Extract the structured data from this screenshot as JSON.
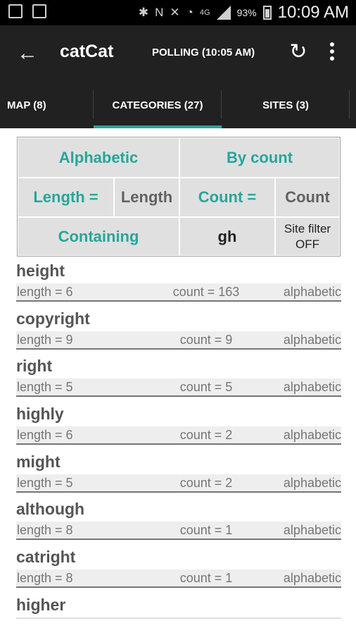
{
  "status_bar": {
    "battery": "93%",
    "time": "10:09 AM",
    "network": "4G"
  },
  "app_bar": {
    "title": "catCat",
    "polling": "POLLING (10:05 AM)"
  },
  "tabs": [
    {
      "label": "MAP (8)",
      "selected": false
    },
    {
      "label": "CATEGORIES (27)",
      "selected": true
    },
    {
      "label": "SITES (3)",
      "selected": false
    }
  ],
  "filters": {
    "alphabetic": "Alphabetic",
    "by_count": "By count",
    "length_eq": "Length =",
    "length": "Length",
    "count_eq": "Count =",
    "count": "Count",
    "containing": "Containing",
    "contains_value": "gh",
    "site_filter_line1": "Site filter",
    "site_filter_line2": "OFF"
  },
  "accent_color": "#26a69a",
  "results": [
    {
      "name": "height",
      "length": "length = 6",
      "count": "count = 163",
      "order": "alphabetic"
    },
    {
      "name": "copyright",
      "length": "length = 9",
      "count": "count = 9",
      "order": "alphabetic"
    },
    {
      "name": "right",
      "length": "length = 5",
      "count": "count = 5",
      "order": "alphabetic"
    },
    {
      "name": "highly",
      "length": "length = 6",
      "count": "count = 2",
      "order": "alphabetic"
    },
    {
      "name": "might",
      "length": "length = 5",
      "count": "count = 2",
      "order": "alphabetic"
    },
    {
      "name": "although",
      "length": "length = 8",
      "count": "count = 1",
      "order": "alphabetic"
    },
    {
      "name": "catright",
      "length": "length = 8",
      "count": "count = 1",
      "order": "alphabetic"
    },
    {
      "name": "higher"
    }
  ]
}
